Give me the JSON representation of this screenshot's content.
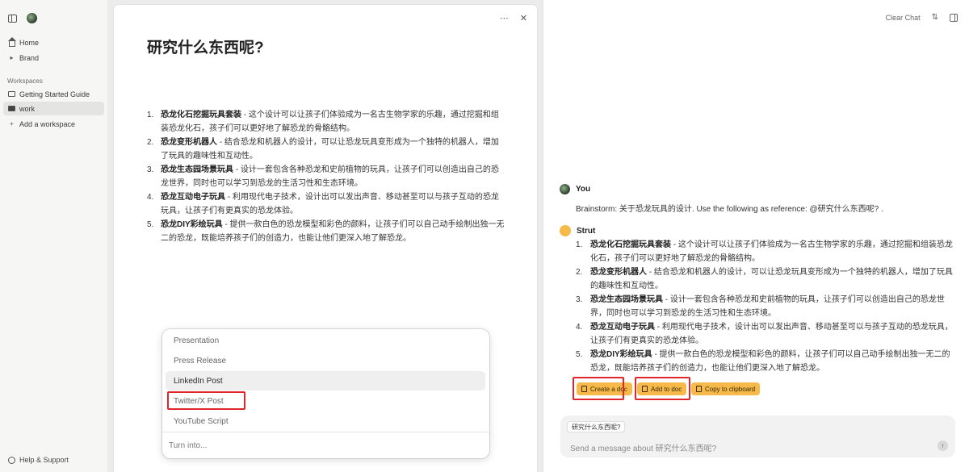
{
  "sidebar": {
    "home": "Home",
    "brand": "Brand",
    "workspaces_heading": "Workspaces",
    "getting_started": "Getting Started Guide",
    "work": "work",
    "add_workspace": "Add a workspace",
    "help": "Help & Support"
  },
  "doc": {
    "title": "研究什么东西呢?",
    "items": [
      {
        "num": "1.",
        "head": "恐龙化石挖掘玩具套装",
        "body": " - 这个设计可以让孩子们体验成为一名古生物学家的乐趣，通过挖掘和组装恐龙化石，孩子们可以更好地了解恐龙的骨骼结构。"
      },
      {
        "num": "2.",
        "head": "恐龙变形机器人",
        "body": " - 结合恐龙和机器人的设计，可以让恐龙玩具变形成为一个独特的机器人，增加了玩具的趣味性和互动性。"
      },
      {
        "num": "3.",
        "head": "恐龙生态园场景玩具",
        "body": " - 设计一套包含各种恐龙和史前植物的玩具，让孩子们可以创造出自己的恐龙世界，同时也可以学习到恐龙的生活习性和生态环境。"
      },
      {
        "num": "4.",
        "head": "恐龙互动电子玩具",
        "body": " - 利用现代电子技术，设计出可以发出声音、移动甚至可以与孩子互动的恐龙玩具，让孩子们有更真实的恐龙体验。"
      },
      {
        "num": "5.",
        "head": "恐龙DIY彩绘玩具",
        "body": " - 提供一款白色的恐龙模型和彩色的颜料，让孩子们可以自己动手绘制出独一无二的恐龙，既能培养孩子们的创造力，也能让他们更深入地了解恐龙。"
      }
    ]
  },
  "popup": {
    "options": [
      "Presentation",
      "Press Release",
      "LinkedIn Post",
      "Twitter/X Post",
      "YouTube Script"
    ],
    "input_placeholder": "Turn into..."
  },
  "chat": {
    "clear": "Clear Chat",
    "user_name": "You",
    "user_message": "Brainstorm: 关于恐龙玩具的设计. Use the following as reference: @研究什么东西呢? .",
    "bot_name": "Strut",
    "buttons": {
      "create": "Create a doc",
      "add": "Add to doc",
      "copy": "Copy to clipboard"
    },
    "context_chip": "研究什么东西呢?",
    "composer_placeholder": "Send a message about 研究什么东西呢?"
  }
}
